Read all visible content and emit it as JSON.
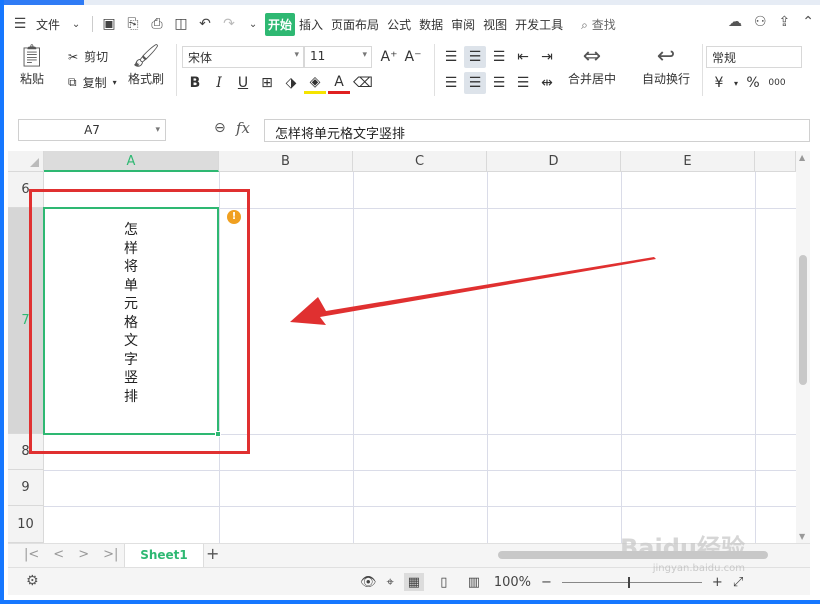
{
  "menu": {
    "file_label": "文件",
    "tabs": [
      "开始",
      "插入",
      "页面布局",
      "公式",
      "数据",
      "审阅",
      "视图",
      "开发工具"
    ],
    "active_tab": "开始",
    "search_label": "查找"
  },
  "ribbon": {
    "paste": "粘贴",
    "cut": "剪切",
    "copy": "复制",
    "format_painter": "格式刷",
    "font_name": "宋体",
    "font_size": "11",
    "merge_center": "合并居中",
    "wrap_text": "自动换行",
    "number_format": "常规",
    "currency_symbol": "¥",
    "percent_symbol": "%",
    "thousands_symbol": "000"
  },
  "formula_bar": {
    "cell_ref": "A7",
    "fx": "fx",
    "content": "怎样将单元格文字竖排"
  },
  "grid": {
    "columns": [
      "A",
      "B",
      "C",
      "D",
      "E"
    ],
    "rows": [
      "6",
      "7",
      "8",
      "9",
      "10"
    ],
    "selected_col": "A",
    "selected_row": "7",
    "cell_text": "怎样将单元格文字竖排",
    "warning_mark": "!"
  },
  "sheets": {
    "tabs": [
      "Sheet1"
    ],
    "add": "+"
  },
  "status": {
    "zoom": "100%"
  },
  "watermark": {
    "main": "Baidu经验",
    "sub": "jingyan.baidu.com"
  },
  "colors": {
    "accent_green": "#2eb872",
    "annotation_red": "#e03030"
  }
}
